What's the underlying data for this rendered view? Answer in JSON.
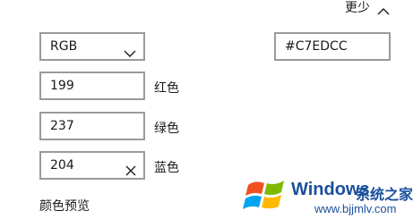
{
  "header": {
    "less_label": "更少"
  },
  "model_select": {
    "selected": "RGB"
  },
  "hex_input": {
    "value": "#C7EDCC"
  },
  "channels": [
    {
      "value": "199",
      "label": "红色"
    },
    {
      "value": "237",
      "label": "绿色"
    },
    {
      "value": "204",
      "label": "蓝色"
    }
  ],
  "preview_label": "颜色预览",
  "watermark": {
    "brand": "Windows",
    "site_name": "系统之家",
    "url": "www.bjjmlv.com"
  },
  "colors": {
    "hex_color": "#C7EDCC",
    "field_border": "#9A9A9A"
  }
}
